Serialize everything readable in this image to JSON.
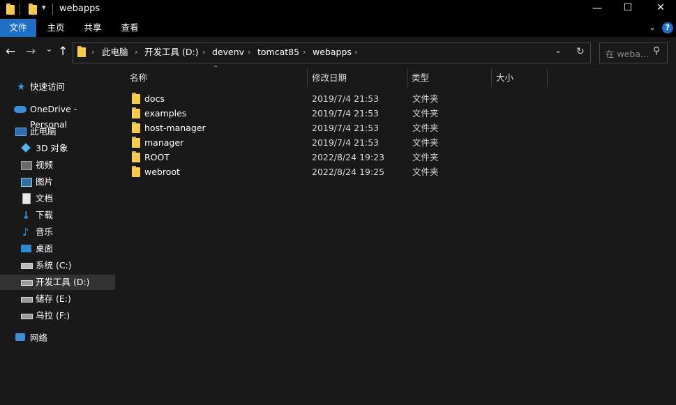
{
  "window": {
    "title": "webapps",
    "controls": {
      "minimize": "—",
      "maximize": "☐",
      "close": "✕"
    }
  },
  "ribbon": {
    "tabs": [
      {
        "label": "文件",
        "active": true
      },
      {
        "label": "主页"
      },
      {
        "label": "共享"
      },
      {
        "label": "查看"
      }
    ],
    "help": "?",
    "accent": "#1f6fc5"
  },
  "nav": {
    "back": "←",
    "forward": "→",
    "recent": "⌄",
    "up": "↑",
    "breadcrumb": [
      "此电脑",
      "开发工具 (D:)",
      "devenv",
      "tomcat85",
      "webapps"
    ],
    "separator": "›",
    "search_placeholder": "在 weba..."
  },
  "sidebar": {
    "quick_access": "快速访问",
    "onedrive": "OneDrive - Personal",
    "this_pc": "此电脑",
    "pc_items": [
      {
        "label": "3D 对象",
        "icon": "3d-objects-icon"
      },
      {
        "label": "视频",
        "icon": "video-icon"
      },
      {
        "label": "图片",
        "icon": "pictures-icon"
      },
      {
        "label": "文档",
        "icon": "documents-icon"
      },
      {
        "label": "下载",
        "icon": "download-icon"
      },
      {
        "label": "音乐",
        "icon": "music-icon"
      },
      {
        "label": "桌面",
        "icon": "desktop-icon"
      },
      {
        "label": "系统 (C:)",
        "icon": "drive-icon"
      },
      {
        "label": "开发工具 (D:)",
        "icon": "drive-icon",
        "selected": true
      },
      {
        "label": "储存 (E:)",
        "icon": "drive-icon"
      },
      {
        "label": "乌拉 (F:)",
        "icon": "drive-icon"
      }
    ],
    "network": "网络"
  },
  "columns": {
    "name": "名称",
    "modified": "修改日期",
    "type": "类型",
    "size": "大小"
  },
  "files": [
    {
      "name": "docs",
      "modified": "2019/7/4 21:53",
      "type": "文件夹"
    },
    {
      "name": "examples",
      "modified": "2019/7/4 21:53",
      "type": "文件夹"
    },
    {
      "name": "host-manager",
      "modified": "2019/7/4 21:53",
      "type": "文件夹"
    },
    {
      "name": "manager",
      "modified": "2019/7/4 21:53",
      "type": "文件夹"
    },
    {
      "name": "ROOT",
      "modified": "2022/8/24 19:23",
      "type": "文件夹"
    },
    {
      "name": "webroot",
      "modified": "2022/8/24 19:25",
      "type": "文件夹"
    }
  ]
}
